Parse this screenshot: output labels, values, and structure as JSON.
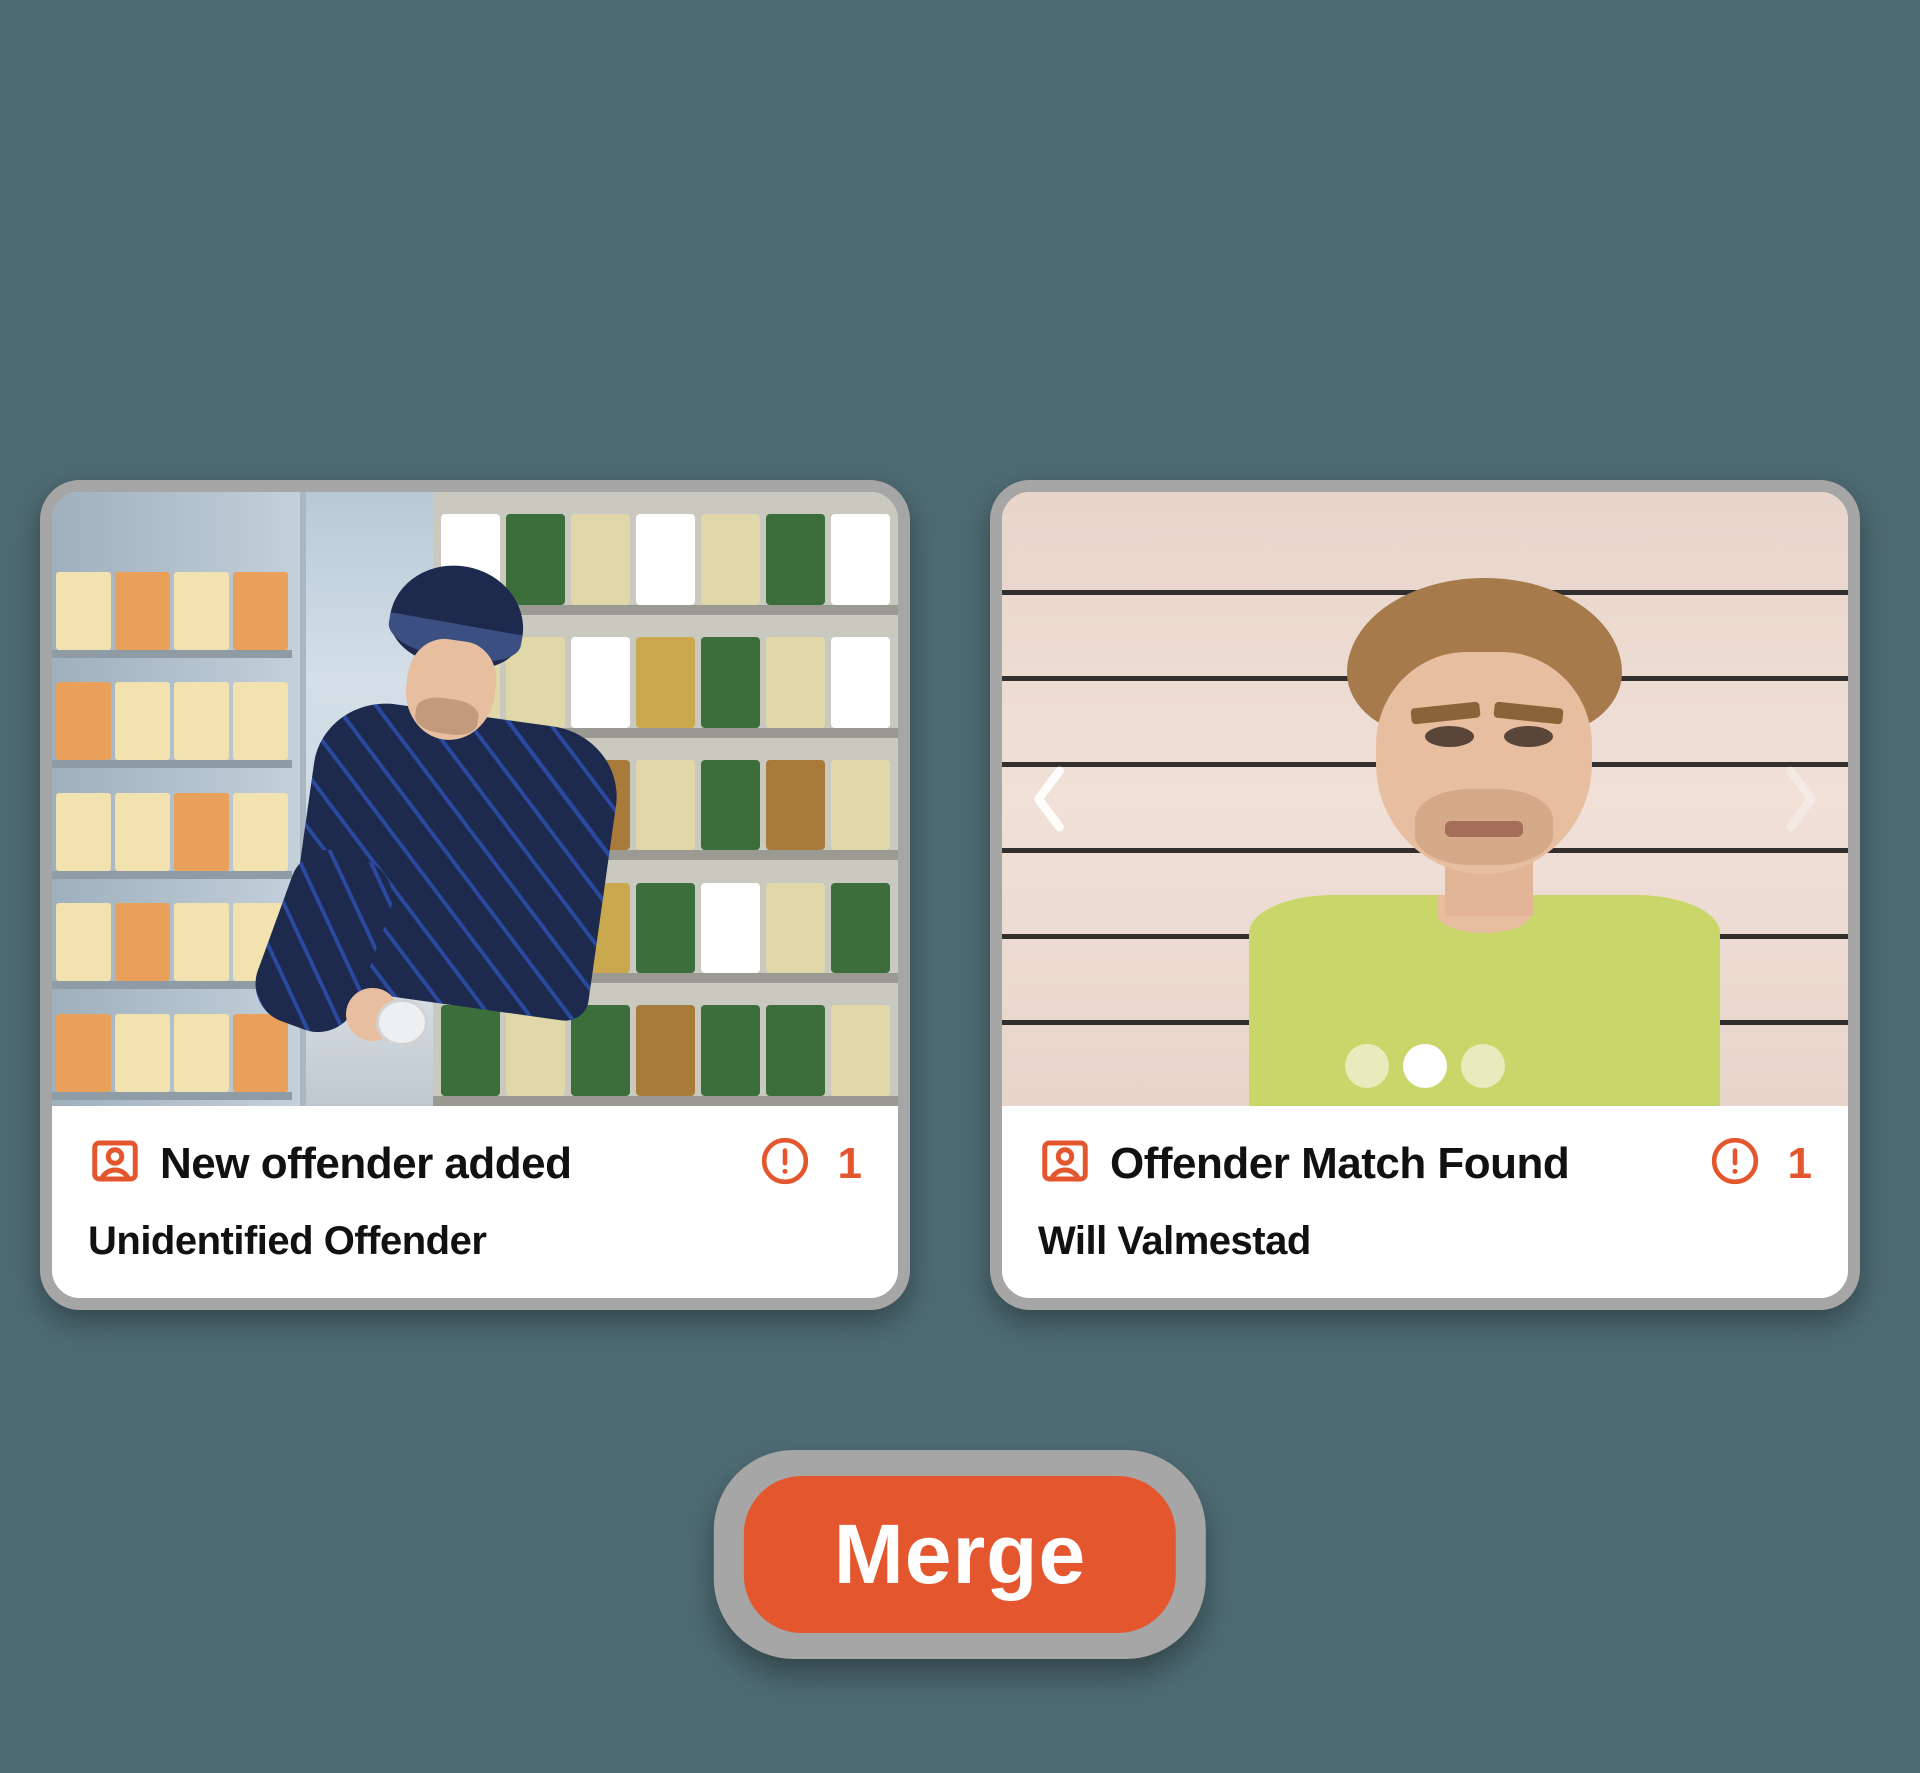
{
  "colors": {
    "accent": "#e4572e",
    "card_border": "#a6a6a6",
    "bg": "#4e6b73"
  },
  "cards": [
    {
      "status_title": "New offender added",
      "alert_count": "1",
      "subtitle": "Unidentified Offender"
    },
    {
      "status_title": "Offender Match Found",
      "alert_count": "1",
      "subtitle": "Will Valmestad"
    }
  ],
  "merge_button_label": "Merge"
}
